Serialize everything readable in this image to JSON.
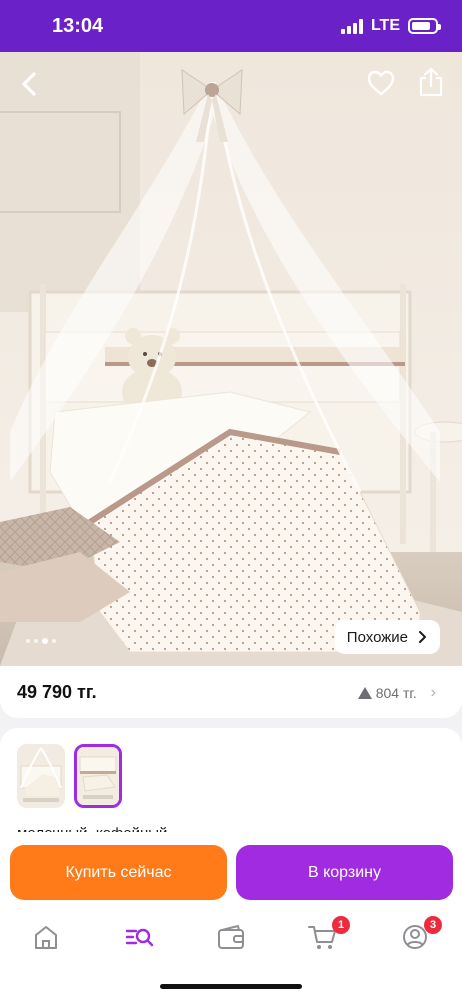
{
  "status_bar": {
    "time": "13:04",
    "network": "LTE",
    "battery_level": 0.8
  },
  "photo": {
    "alt": "crib with canopy, white bedding with a teddy bear",
    "slide_count": 4,
    "active_slide": 3,
    "similar_label": "Похожие",
    "icons": {
      "back": "chevron-left-icon",
      "favorite": "heart-icon",
      "share": "share-icon"
    }
  },
  "product": {
    "price": "49 790 тг.",
    "rating_count": "804 тг."
  },
  "variants": {
    "selected_label": "молочный, кофейный",
    "selected_index": 1
  },
  "actions": {
    "buy_now": "Купить сейчас",
    "add_to_cart": "В корзину"
  },
  "tabbar": {
    "items": [
      {
        "name": "home",
        "icon": "home-icon"
      },
      {
        "name": "catalog",
        "icon": "catalog-search-icon",
        "active": true
      },
      {
        "name": "wallet",
        "icon": "wallet-icon"
      },
      {
        "name": "cart",
        "icon": "cart-icon",
        "badge": "1"
      },
      {
        "name": "profile",
        "icon": "profile-icon",
        "badge": "3"
      }
    ]
  },
  "colors": {
    "brand": "#6b21c8",
    "accent": "#a02be0",
    "buy": "#ff7a18",
    "badge": "#ee2a3e"
  }
}
